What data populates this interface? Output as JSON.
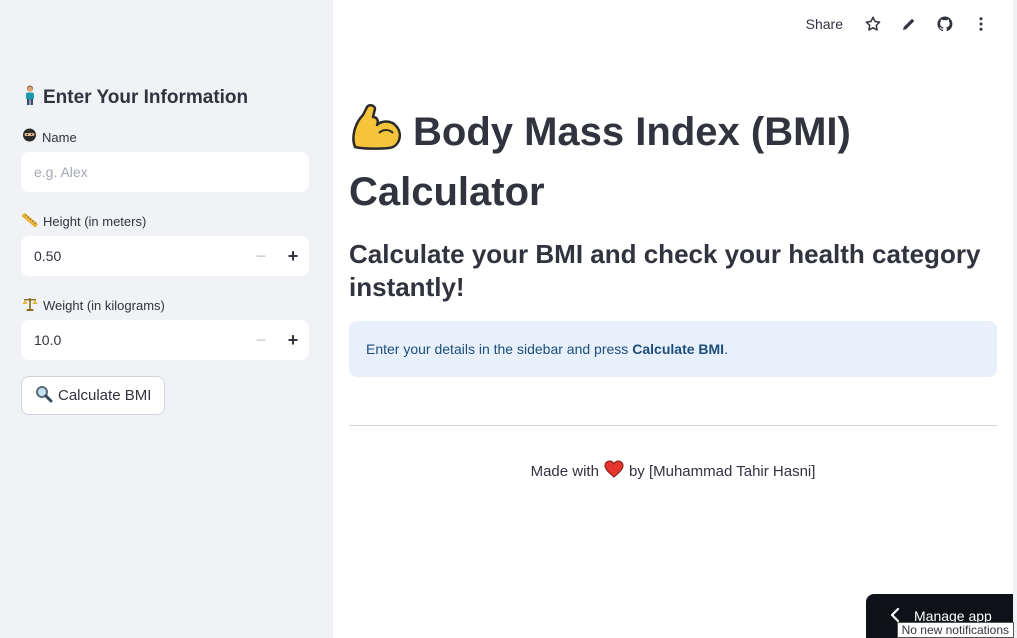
{
  "toolbar": {
    "share_label": "Share",
    "icons": [
      "star-icon",
      "pencil-icon",
      "github-icon",
      "more-vertical-icon"
    ]
  },
  "sidebar": {
    "header": "Enter Your Information",
    "header_emoji": "🧍",
    "name": {
      "label": "Name",
      "emoji": "🥷",
      "placeholder": "e.g. Alex",
      "value": ""
    },
    "height": {
      "label": "Height (in meters)",
      "emoji": "📏",
      "value": "0.50",
      "minus": "−",
      "plus": "+"
    },
    "weight": {
      "label": "Weight (in kilograms)",
      "emoji": "⚖",
      "value": "10.0",
      "minus": "−",
      "plus": "+"
    },
    "button": {
      "label": "Calculate BMI",
      "emoji": "🔍"
    }
  },
  "main": {
    "title": "Body Mass Index (BMI) Calculator",
    "subtitle": "Calculate your BMI and check your health category instantly!",
    "info_prefix": "Enter your details in the sidebar and press",
    "info_bold": "Calculate BMI",
    "info_suffix": ".",
    "footer_prefix": "Made with",
    "footer_suffix": "by [Muhammad Tahir Hasni]"
  },
  "manage_app": {
    "label": "Manage app",
    "tooltip": "No new notifications"
  },
  "colors": {
    "sidebar_bg": "#f0f2f6",
    "info_bg": "#e8f1fb",
    "info_text": "#1d4d7a",
    "text": "#31333f",
    "heart": "#e5352d"
  }
}
